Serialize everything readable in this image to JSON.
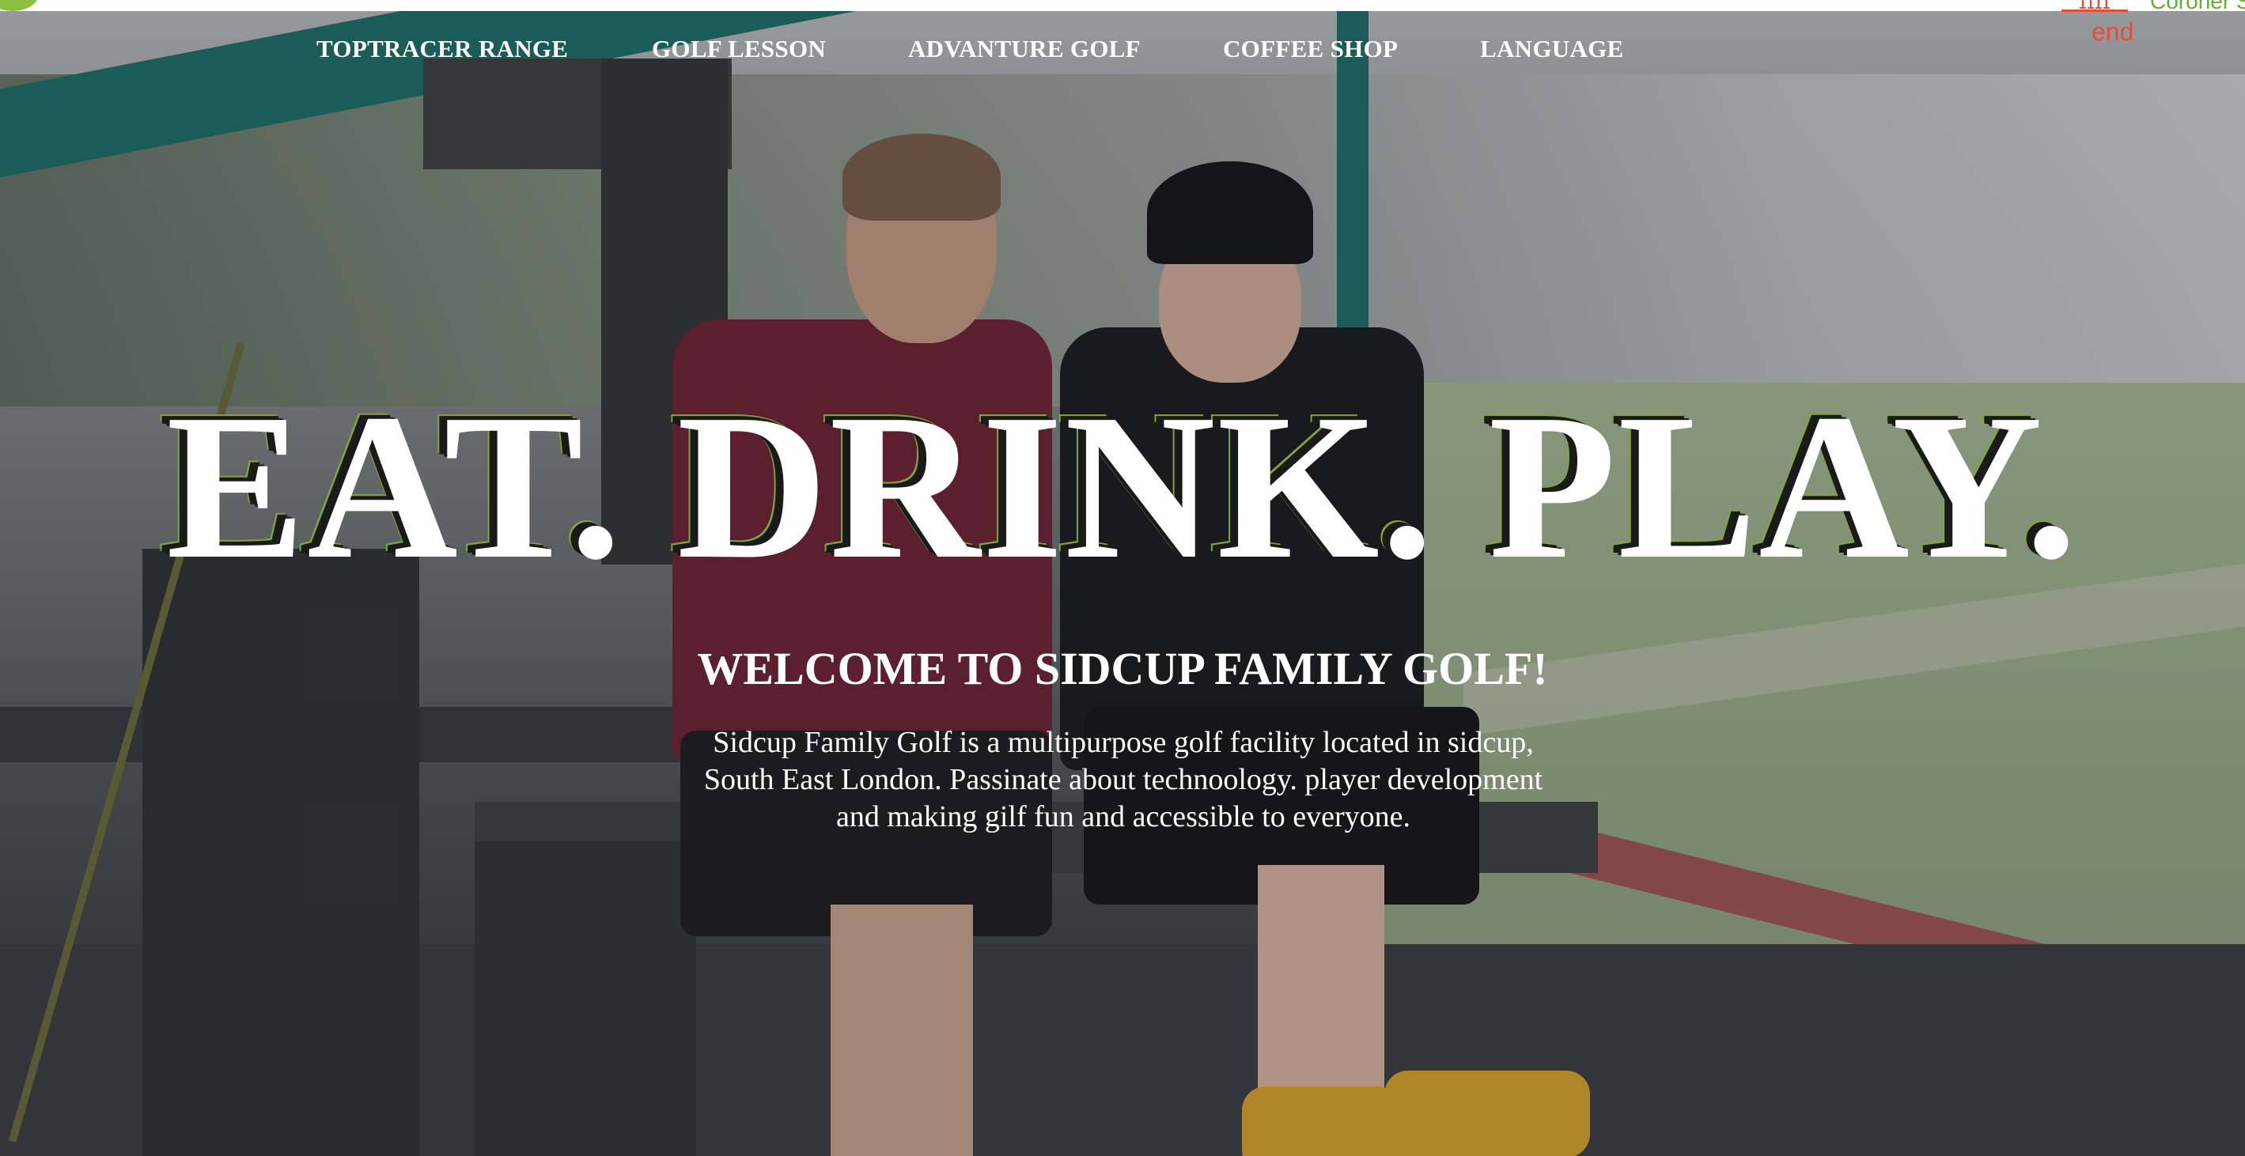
{
  "nav": {
    "items": [
      {
        "label": "TOPTRACER RANGE"
      },
      {
        "label": "GOLF LESSON"
      },
      {
        "label": "ADVANTURE GOLF"
      },
      {
        "label": "COFFEE SHOP"
      },
      {
        "label": "LANGUAGE"
      }
    ]
  },
  "top_right": {
    "tag": "ɪɪɪɪ",
    "green_text": "Coroner Sta",
    "end_label": "end"
  },
  "hero": {
    "headline": "EAT. DRINK. PLAY.",
    "welcome": "WELCOME TO SIDCUP FAMILY GOLF!",
    "intro_lines": [
      "Sidcup Family Golf is a multipurpose golf facility located in sidcup,",
      "South East London. Passinate about technoology. player development",
      "and making gilf fun and accessible to everyone."
    ]
  },
  "colors": {
    "accent_green": "#7ea63a",
    "accent_red": "#e24e3a",
    "text": "#ffffff"
  }
}
